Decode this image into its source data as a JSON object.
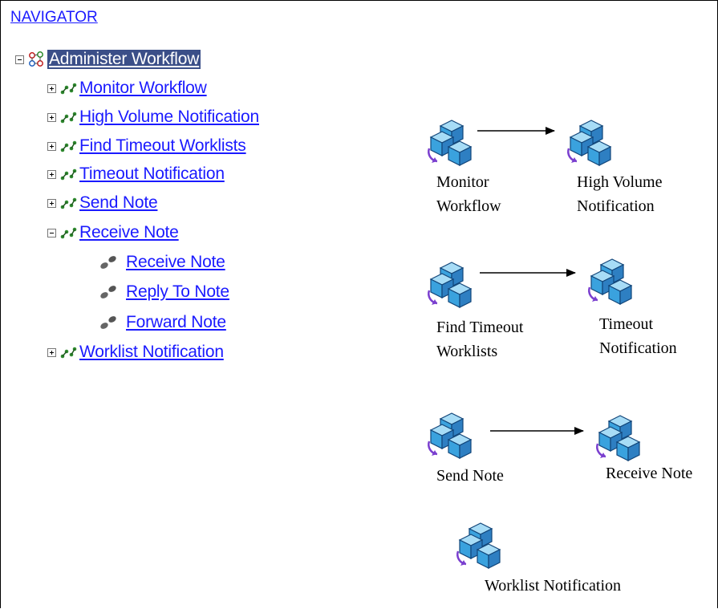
{
  "navigator": {
    "title": "NAVIGATOR"
  },
  "tree": {
    "root": "Administer Workflow",
    "items": [
      "Monitor Workflow",
      "High Volume Notification",
      "Find Timeout Worklists",
      "Timeout Notification",
      "Send Note",
      "Receive Note",
      "Worklist Notification"
    ],
    "receive_note_children": [
      "Receive Note",
      "Reply To Note",
      "Forward Note"
    ]
  },
  "diagram": {
    "monitor": [
      "Monitor",
      "Workflow"
    ],
    "high_volume": [
      "High Volume",
      "Notification"
    ],
    "find_timeout": [
      "Find Timeout",
      "Worklists"
    ],
    "timeout": [
      "Timeout",
      "Notification"
    ],
    "send_note": "Send Note",
    "receive_note": "Receive Note",
    "worklist": "Worklist Notification"
  },
  "colors": {
    "link": "#1a1aff",
    "selected_bg": "#3b4f88",
    "cube_fill": "#3fa9e6",
    "cube_top": "#9fd8f5",
    "cycle_arrow": "#7a3fcf",
    "route_icon": "#2f8a2f"
  }
}
